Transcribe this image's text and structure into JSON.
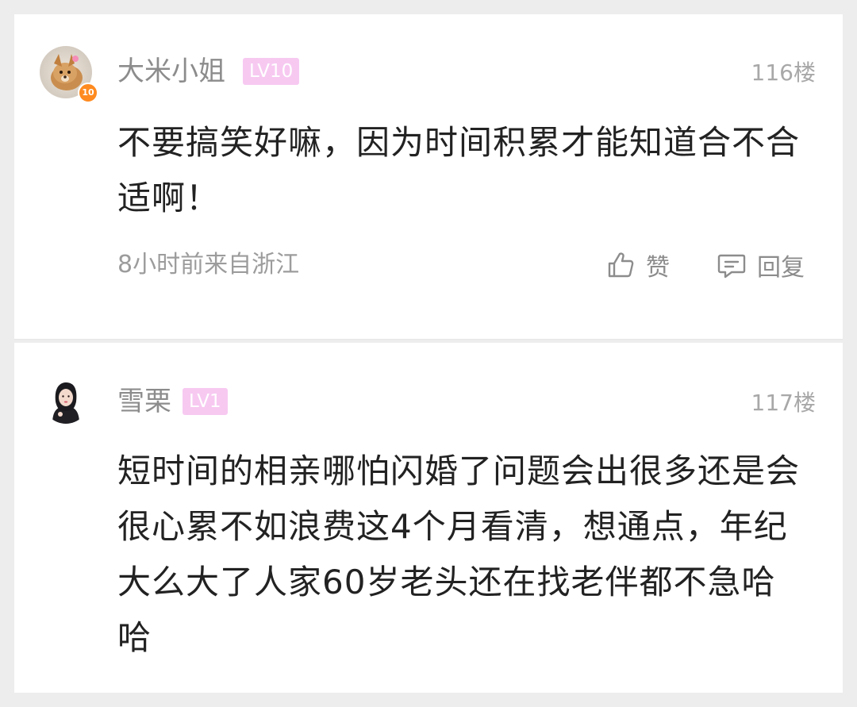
{
  "comments": [
    {
      "username": "大米小姐",
      "level": "LV10",
      "avatar_badge": "10",
      "floor": "116楼",
      "content": "不要搞笑好嘛，因为时间积累才能知道合不合适啊！",
      "meta": "8小时前来自浙江",
      "like_label": "赞",
      "reply_label": "回复"
    },
    {
      "username": "雪栗",
      "level": "LV1",
      "floor": "117楼",
      "content": "短时间的相亲哪怕闪婚了问题会出很多还是会很心累不如浪费这4个月看清，想通点，年纪大么大了人家60岁老头还在找老伴都不急哈哈"
    }
  ],
  "colors": {
    "badge_bg": "#f7c9f1",
    "username": "#8c8c8c",
    "content": "#222222",
    "meta": "#9c9c9c",
    "level_dot": "#ff8a1f"
  },
  "icons": {
    "like": "thumbs-up-icon",
    "reply": "comment-bubble-icon"
  }
}
